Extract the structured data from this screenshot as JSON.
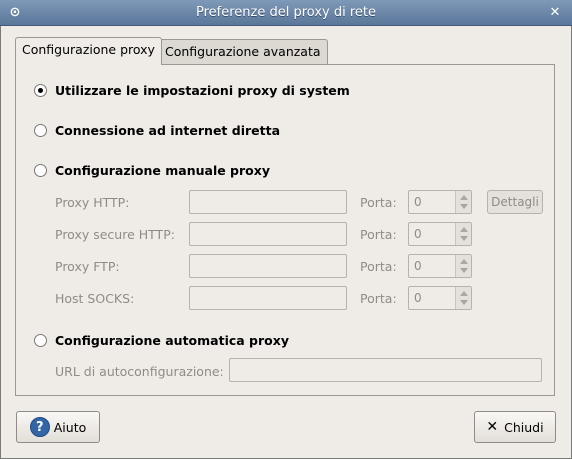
{
  "window": {
    "title": "Preferenze del proxy di rete",
    "menu_icon": "window-menu-icon",
    "close_icon": "close-icon"
  },
  "tabs": [
    {
      "label": "Configurazione proxy",
      "active": true
    },
    {
      "label": "Configurazione avanzata",
      "active": false
    }
  ],
  "options": {
    "system": {
      "label": "Utilizzare le impostazioni proxy di system",
      "checked": true
    },
    "direct": {
      "label": "Connessione ad internet diretta",
      "checked": false
    },
    "manual": {
      "label": "Configurazione manuale proxy",
      "checked": false
    },
    "auto": {
      "label": "Configurazione automatica proxy",
      "checked": false
    }
  },
  "manual": {
    "http_label": "Proxy HTTP:",
    "https_label": "Proxy secure HTTP:",
    "ftp_label": "Proxy FTP:",
    "socks_label": "Host SOCKS:",
    "port_label": "Porta:",
    "http_port": "0",
    "https_port": "0",
    "ftp_port": "0",
    "socks_port": "0",
    "details_label": "Dettagli"
  },
  "auto": {
    "url_label": "URL di autoconfigurazione:"
  },
  "buttons": {
    "help_label": "Aiuto",
    "help_icon": "help-icon",
    "close_label": "Chiudi",
    "close_icon": "close-x-icon"
  }
}
